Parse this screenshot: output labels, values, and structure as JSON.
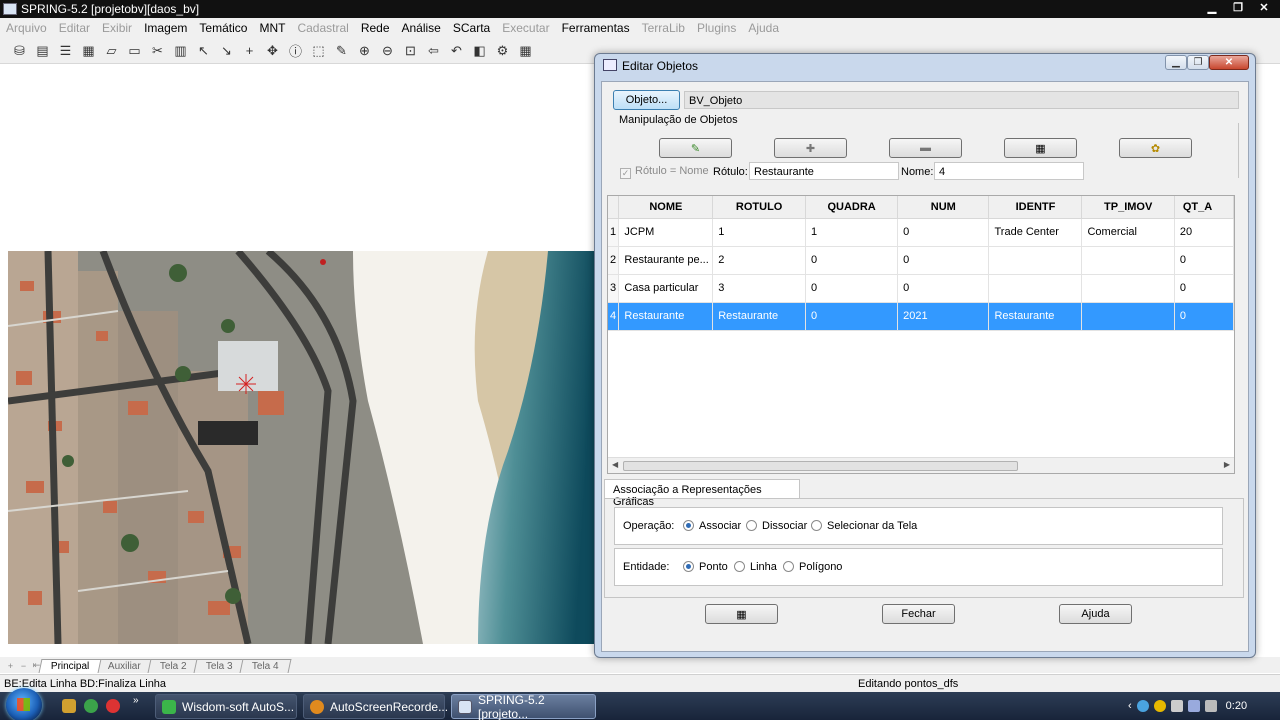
{
  "window": {
    "title": "SPRING-5.2 [projetobv][daos_bv]"
  },
  "menu": [
    {
      "label": "Arquivo",
      "disabled": true
    },
    {
      "label": "Editar",
      "disabled": true
    },
    {
      "label": "Exibir",
      "disabled": true
    },
    {
      "label": "Imagem",
      "disabled": false
    },
    {
      "label": "Temático",
      "disabled": false
    },
    {
      "label": "MNT",
      "disabled": false
    },
    {
      "label": "Cadastral",
      "disabled": true
    },
    {
      "label": "Rede",
      "disabled": false
    },
    {
      "label": "Análise",
      "disabled": false
    },
    {
      "label": "SCarta",
      "disabled": false
    },
    {
      "label": "Executar",
      "disabled": true
    },
    {
      "label": "Ferramentas",
      "disabled": false
    },
    {
      "label": "TerraLib",
      "disabled": true
    },
    {
      "label": "Plugins",
      "disabled": true
    },
    {
      "label": "Ajuda",
      "disabled": true
    }
  ],
  "dialog": {
    "title": "Editar Objetos",
    "objeto_button": "Objeto...",
    "objeto_value": "BV_Objeto",
    "manip_label": "Manipulação de Objetos",
    "rotulo_nome_check": "Rótulo = Nome",
    "rotulo_label": "Rótulo:",
    "rotulo_value": "Restaurante",
    "nome_label": "Nome:",
    "nome_value": "4",
    "table": {
      "columns": [
        "NOME",
        "ROTULO",
        "QUADRA",
        "NUM",
        "IDENTF",
        "TP_IMOV",
        "QT_A"
      ],
      "rows": [
        {
          "num": "1",
          "cells": [
            "JCPM",
            "1",
            "1",
            "0",
            "Trade Center",
            "Comercial",
            "20"
          ]
        },
        {
          "num": "2",
          "cells": [
            "Restaurante pe...",
            "2",
            "0",
            "0",
            "",
            "",
            "0"
          ]
        },
        {
          "num": "3",
          "cells": [
            "Casa particular",
            "3",
            "0",
            "0",
            "",
            "",
            "0"
          ]
        },
        {
          "num": "4",
          "cells": [
            "Restaurante",
            "Restaurante",
            "0",
            "2021",
            "Restaurante",
            "",
            "0"
          ]
        }
      ],
      "selected_row": 4
    },
    "assoc_tab": "Associação a Representações Gráficas",
    "operacao_label": "Operação:",
    "operacao_options": [
      "Associar",
      "Dissociar",
      "Selecionar da Tela"
    ],
    "operacao_selected": "Associar",
    "entidade_label": "Entidade:",
    "entidade_options": [
      "Ponto",
      "Linha",
      "Polígono"
    ],
    "entidade_selected": "Ponto",
    "fechar_button": "Fechar",
    "ajuda_button": "Ajuda"
  },
  "view_tabs": [
    "Principal",
    "Auxiliar",
    "Tela 2",
    "Tela 3",
    "Tela 4"
  ],
  "active_view_tab": "Principal",
  "status": {
    "left": "BE:Edita Linha  BD:Finaliza Linha",
    "right": "Editando pontos_dfs"
  },
  "taskbar": {
    "tasks": [
      "Wisdom-soft AutoS...",
      "AutoScreenRecorde...",
      "SPRING-5.2 [projeto..."
    ],
    "clock": "0:20"
  },
  "colors": {
    "selection": "#3399ff",
    "dialog_frame": "#c9d8ec",
    "taskbar": "#1f2d45"
  }
}
